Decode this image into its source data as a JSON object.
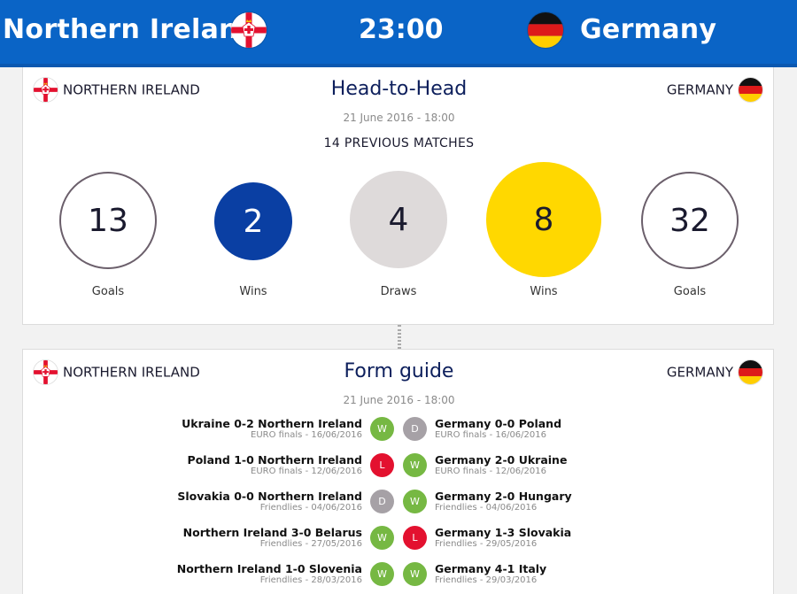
{
  "header": {
    "home_team": "Northern Ireland",
    "away_team": "Germany",
    "kickoff_time": "23:00",
    "background_color": "#0a64c6"
  },
  "head_to_head": {
    "title": "Head-to-Head",
    "home_label": "NORTHERN IRELAND",
    "away_label": "GERMANY",
    "date": "21 June 2016 - 18:00",
    "previous_matches": "14 PREVIOUS MATCHES",
    "stats": [
      {
        "value": "13",
        "label": "Goals",
        "style": "outline"
      },
      {
        "value": "2",
        "label": "Wins",
        "style": "home-blue",
        "color": "#0a3fa3"
      },
      {
        "value": "4",
        "label": "Draws",
        "style": "grey",
        "color": "#dedada"
      },
      {
        "value": "8",
        "label": "Wins",
        "style": "away-yellow",
        "color": "#ffd800"
      },
      {
        "value": "32",
        "label": "Goals",
        "style": "outline"
      }
    ]
  },
  "form_guide": {
    "title": "Form guide",
    "home_label": "NORTHERN IRELAND",
    "away_label": "GERMANY",
    "date": "21 June 2016 - 18:00",
    "rows": [
      {
        "home_match": "Ukraine 0-2 Northern Ireland",
        "home_sub": "EURO finals - 16/06/2016",
        "home_result": "W",
        "away_result": "D",
        "away_match": "Germany 0-0 Poland",
        "away_sub": "EURO finals - 16/06/2016"
      },
      {
        "home_match": "Poland 1-0 Northern Ireland",
        "home_sub": "EURO finals - 12/06/2016",
        "home_result": "L",
        "away_result": "W",
        "away_match": "Germany 2-0 Ukraine",
        "away_sub": "EURO finals - 12/06/2016"
      },
      {
        "home_match": "Slovakia 0-0 Northern Ireland",
        "home_sub": "Friendlies - 04/06/2016",
        "home_result": "D",
        "away_result": "W",
        "away_match": "Germany 2-0 Hungary",
        "away_sub": "Friendlies - 04/06/2016"
      },
      {
        "home_match": "Northern Ireland 3-0 Belarus",
        "home_sub": "Friendlies - 27/05/2016",
        "home_result": "W",
        "away_result": "L",
        "away_match": "Germany 1-3 Slovakia",
        "away_sub": "Friendlies - 29/05/2016"
      },
      {
        "home_match": "Northern Ireland 1-0 Slovenia",
        "home_sub": "Friendlies - 28/03/2016",
        "home_result": "W",
        "away_result": "W",
        "away_match": "Germany 4-1 Italy",
        "away_sub": "Friendlies - 29/03/2016"
      }
    ],
    "result_colors": {
      "W": "#76b843",
      "D": "#a6a1a6",
      "L": "#e3112f"
    }
  }
}
